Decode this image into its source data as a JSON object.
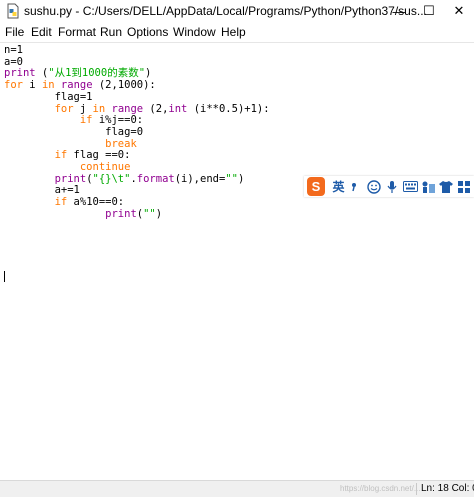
{
  "window": {
    "title": "sushu.py - C:/Users/DELL/AppData/Local/Programs/Python/Python37/sus...",
    "app_icon": "python-file-icon",
    "controls": {
      "minimize": "—",
      "maximize": "☐",
      "close": "✕"
    }
  },
  "menu": {
    "items": [
      {
        "label": "File"
      },
      {
        "label": "Edit"
      },
      {
        "label": "Format"
      },
      {
        "label": "Run"
      },
      {
        "label": "Options"
      },
      {
        "label": "Window"
      },
      {
        "label": "Help"
      }
    ]
  },
  "editor": {
    "code_lines": [
      "n=1",
      "a=0",
      "print (\"从1到1000的素数\")",
      "for i in range (2,1000):",
      "        flag=1",
      "        for j in range (2,int (i**0.5)+1):",
      "            if i%j==0:",
      "                flag=0",
      "                break",
      "        if flag ==0:",
      "            continue",
      "        print(\"{}\\t\".format(i),end=\"\")",
      "        a+=1",
      "        if a%10==0:",
      "                print(\"\")"
    ],
    "syntax_colors": {
      "keyword": "#ff7700",
      "builtin": "#900090",
      "string": "#00aa00",
      "default": "#000000"
    }
  },
  "ime_toolbar": {
    "logo": "S",
    "language": "英",
    "icons": [
      "punctuation-icon",
      "emoji-icon",
      "microphone-icon",
      "keyboard-icon",
      "toolbox-icon",
      "skin-shirt-icon",
      "grid-menu-icon"
    ]
  },
  "statusbar": {
    "watermark": "https://blog.csdn.net/...",
    "position": "Ln: 18  Col: 0"
  }
}
